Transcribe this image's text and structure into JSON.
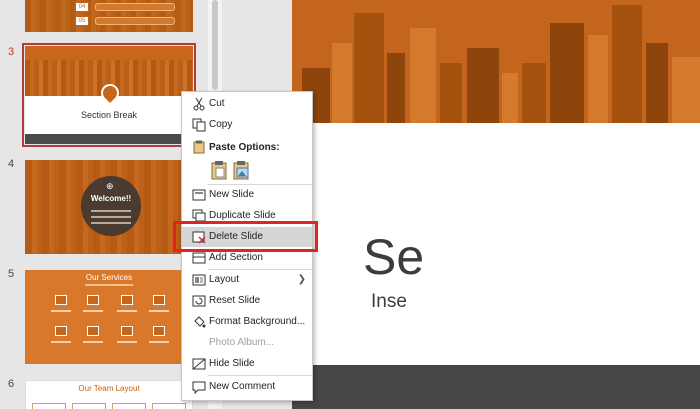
{
  "slides": [
    {
      "number": "",
      "boxes": [
        "04",
        "05"
      ]
    },
    {
      "number": "3",
      "title": "Section Break"
    },
    {
      "number": "4",
      "title": "Welcome!!"
    },
    {
      "number": "5",
      "title": "Our Services"
    },
    {
      "number": "6",
      "title": "Our Team Layout"
    }
  ],
  "main_slide": {
    "title_partial": "Se",
    "subtitle_partial": "Inse"
  },
  "context_menu": {
    "cut": "Cut",
    "copy": "Copy",
    "paste_options": "Paste Options:",
    "new_slide": "New Slide",
    "duplicate_slide": "Duplicate Slide",
    "delete_slide": "Delete Slide",
    "add_section": "Add Section",
    "layout": "Layout",
    "reset_slide": "Reset Slide",
    "format_background": "Format Background...",
    "photo_album": "Photo Album...",
    "hide_slide": "Hide Slide",
    "new_comment": "New Comment"
  },
  "colors": {
    "accent_orange": "#c8661c",
    "highlight_red": "#e02424",
    "dark_footer": "#464646"
  }
}
